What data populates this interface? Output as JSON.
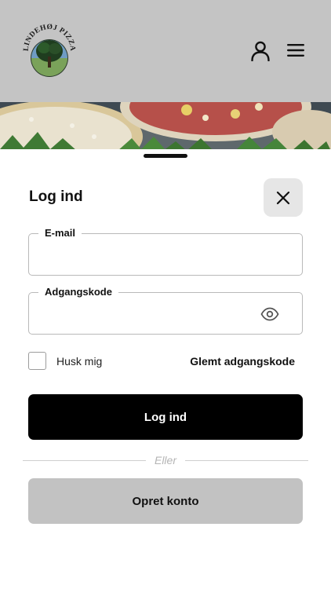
{
  "header": {
    "logo_text": "LINDEHØJ PIZZA",
    "background": "#c4c4c4",
    "user_icon": "user-icon",
    "menu_icon": "hamburger-menu-icon"
  },
  "login_sheet": {
    "title": "Log ind",
    "close_icon": "close-icon",
    "email": {
      "label": "E-mail",
      "value": ""
    },
    "password": {
      "label": "Adgangskode",
      "value": "",
      "toggle_icon": "eye-icon"
    },
    "remember_me": {
      "label": "Husk mig",
      "checked": false
    },
    "forgot_password": "Glemt adgangskode",
    "login_button": "Log ind",
    "divider_text": "Eller",
    "signup_button": "Opret konto"
  },
  "colors": {
    "primary_button": "#000000",
    "secondary_button": "#c2c2c2",
    "close_button_bg": "#e6e6e6",
    "field_border": "#b9b9b9"
  }
}
